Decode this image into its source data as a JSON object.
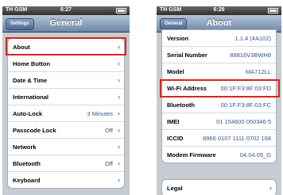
{
  "left_screen": {
    "status": {
      "carrier": "TH GSM",
      "time": "6:27"
    },
    "nav": {
      "back_label": "Settings",
      "title": "General"
    },
    "rows": [
      {
        "label": "About",
        "value": ""
      },
      {
        "label": "Home Button",
        "value": ""
      },
      {
        "label": "Date & Time",
        "value": ""
      },
      {
        "label": "International",
        "value": ""
      },
      {
        "label": "Auto-Lock",
        "value": "3 Minutes"
      },
      {
        "label": "Passcode Lock",
        "value": "Off"
      },
      {
        "label": "Network",
        "value": ""
      },
      {
        "label": "Bluetooth",
        "value": "Off"
      },
      {
        "label": "Keyboard",
        "value": ""
      }
    ]
  },
  "right_screen": {
    "status": {
      "carrier": "TH GSM",
      "time": "6:28"
    },
    "nav": {
      "back_label": "General",
      "title": "About"
    },
    "rows": [
      {
        "label": "Version",
        "value": "1.1.4 (4A102)"
      },
      {
        "label": "Serial Number",
        "value": "88816V3BWH8"
      },
      {
        "label": "Model",
        "value": "MA712LL"
      },
      {
        "label": "Wi-Fi Address",
        "value": "00:1F:F3:8F:03:FD"
      },
      {
        "label": "Bluetooth",
        "value": "00:1F:F3:8F:03:FC"
      },
      {
        "label": "IMEI",
        "value": "01 154600 050346 5"
      },
      {
        "label": "ICCID",
        "value": "8966 0107 1111 0702 168"
      },
      {
        "label": "Modem Firmware",
        "value": "04.04.05_G"
      }
    ],
    "legal_row": {
      "label": "Legal"
    }
  },
  "colors": {
    "highlight": "#e02020",
    "value_blue": "#385487"
  }
}
